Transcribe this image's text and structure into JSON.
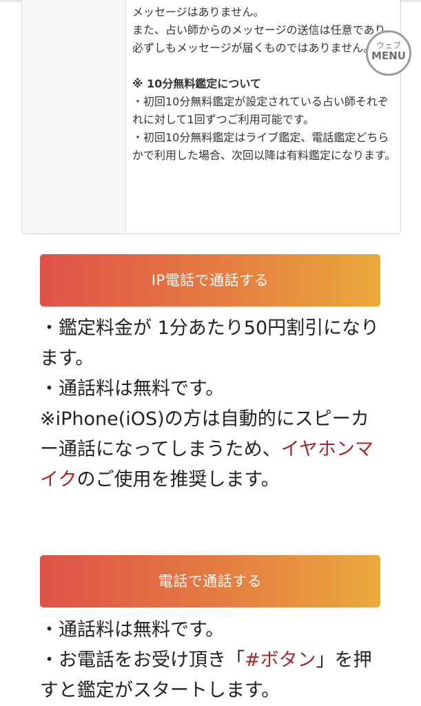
{
  "info_box": {
    "lines_top": [
      "メッセージはありません。",
      "また、占い師からのメッセージの送信は任意であり、必ずしもメッセージが届くものではありません。"
    ],
    "free_heading": "※ 10分無料鑑定について",
    "free_items": [
      "・初回10分無料鑑定が設定されている占い師それぞれに対して1回ずつご利用可能です。",
      "・初回10分無料鑑定はライブ鑑定、電話鑑定どちらかで利用した場合、次回以降は有料鑑定になります。"
    ]
  },
  "menu_badge": {
    "line1": "ウェブ",
    "line2": "MENU",
    "icon": "web-menu-icon"
  },
  "ip_call": {
    "button_label": "IP電話で通話する",
    "desc": {
      "line1": "・鑑定料金が 1分あたり50円割引になります。",
      "line2": "・通話料は無料です。",
      "line3_pre": "※iPhone(iOS)の方は自動的にスピーカー通話になってしまうため、",
      "line3_link": "イヤホンマイク",
      "line3_post": "のご使用を推奨します。"
    }
  },
  "phone_call": {
    "button_label": "電話で通話する",
    "desc": {
      "line1": "・通話料は無料です。",
      "line2_pre": "・お電話をお受け頂き「",
      "line2_link": "#ボタン",
      "line2_post": "」を押すと鑑定がスタートします。"
    }
  },
  "colors": {
    "button_gradient_start": "#df5248",
    "button_gradient_end": "#eaa93b",
    "link_red": "#a8252a"
  }
}
